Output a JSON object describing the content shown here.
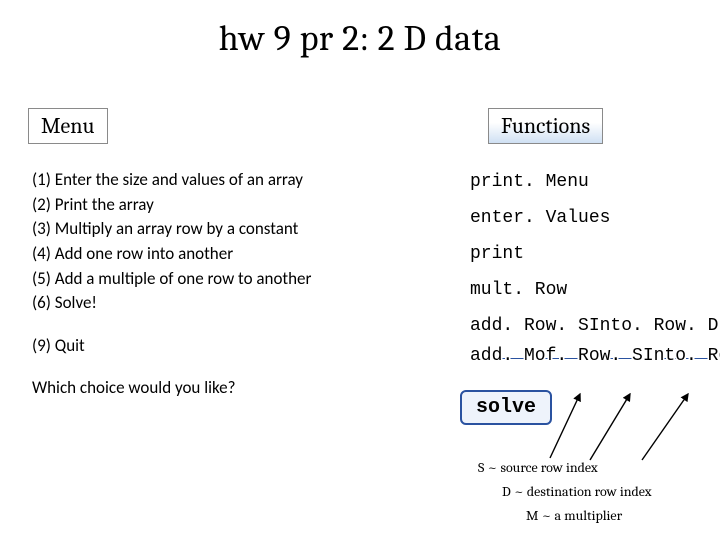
{
  "title": "hw 9 pr 2:  2 D data",
  "menu_header": "Menu",
  "functions_header": "Functions",
  "menu_items": [
    "(1) Enter the size and values of an array",
    "(2) Print the array",
    "(3) Multiply an array row by a constant",
    "(4) Add one row into another",
    "(5) Add a multiple of one row to another",
    "(6) Solve!"
  ],
  "menu_quit": "(9) Quit",
  "menu_prompt": "Which choice would you like?",
  "functions": [
    "print. Menu",
    "enter. Values",
    "print",
    "mult. Row",
    "add. Row. SInto. Row. D",
    "add. Mof. Row. SInto. Row. D"
  ],
  "solve_label": "solve",
  "legend_s": "S ~ source row index",
  "legend_d": "D ~ destination row index",
  "legend_m": "M ~ a multiplier"
}
